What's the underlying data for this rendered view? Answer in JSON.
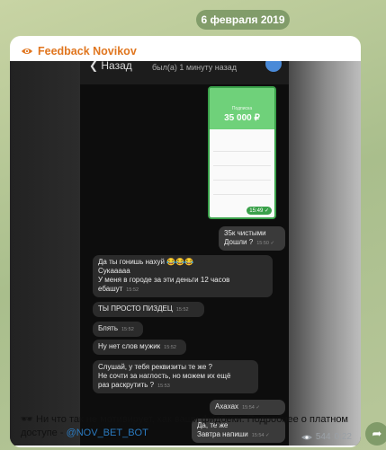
{
  "date_pill": "6 февраля 2019",
  "channel": {
    "name": "Feedback Novikov",
    "icon": "eye-icon"
  },
  "photo": {
    "phone_header": {
      "back": "❮ Назад",
      "seen": "был(а) 1 минуту назад"
    },
    "screenshot": {
      "sub": "Подписка",
      "amount": "35 000 ₽",
      "time": "15:49 ✓"
    },
    "messages": [
      {
        "text": "35к чистыми\nДошли ?",
        "time": "15:50 ✓"
      },
      {
        "text": "Да ты гонишь нахуй 😂😂😂\nСукааааа\nУ меня в городе за эти деньги 12 часов\nебашут",
        "time": "15:52"
      },
      {
        "text": "ТЫ ПРОСТО ПИЗДЕЦ",
        "time": "15:52"
      },
      {
        "text": "Блять",
        "time": "15:52"
      },
      {
        "text": "Ну нет слов мужик",
        "time": "15:52"
      },
      {
        "text": "Слушай, у тебя реквизиты те же ?\nНе сочти за наглость, но можем их ещё\nраз раскрутить ?",
        "time": "15:53"
      },
      {
        "text": "Ахахах",
        "time": "15:54 ✓"
      },
      {
        "text": "Да, те же\nЗавтра напиши",
        "time": "15:54 ✓"
      }
    ]
  },
  "caption": {
    "text": "🕶 Ни что так не мотивирует, как ваши фидбеки. Подробнее о платном доступе - ",
    "handle": "@NOV_BET_BOT"
  },
  "meta": {
    "views": "544",
    "time": "0:22"
  },
  "share_icon": "share-arrow-icon"
}
